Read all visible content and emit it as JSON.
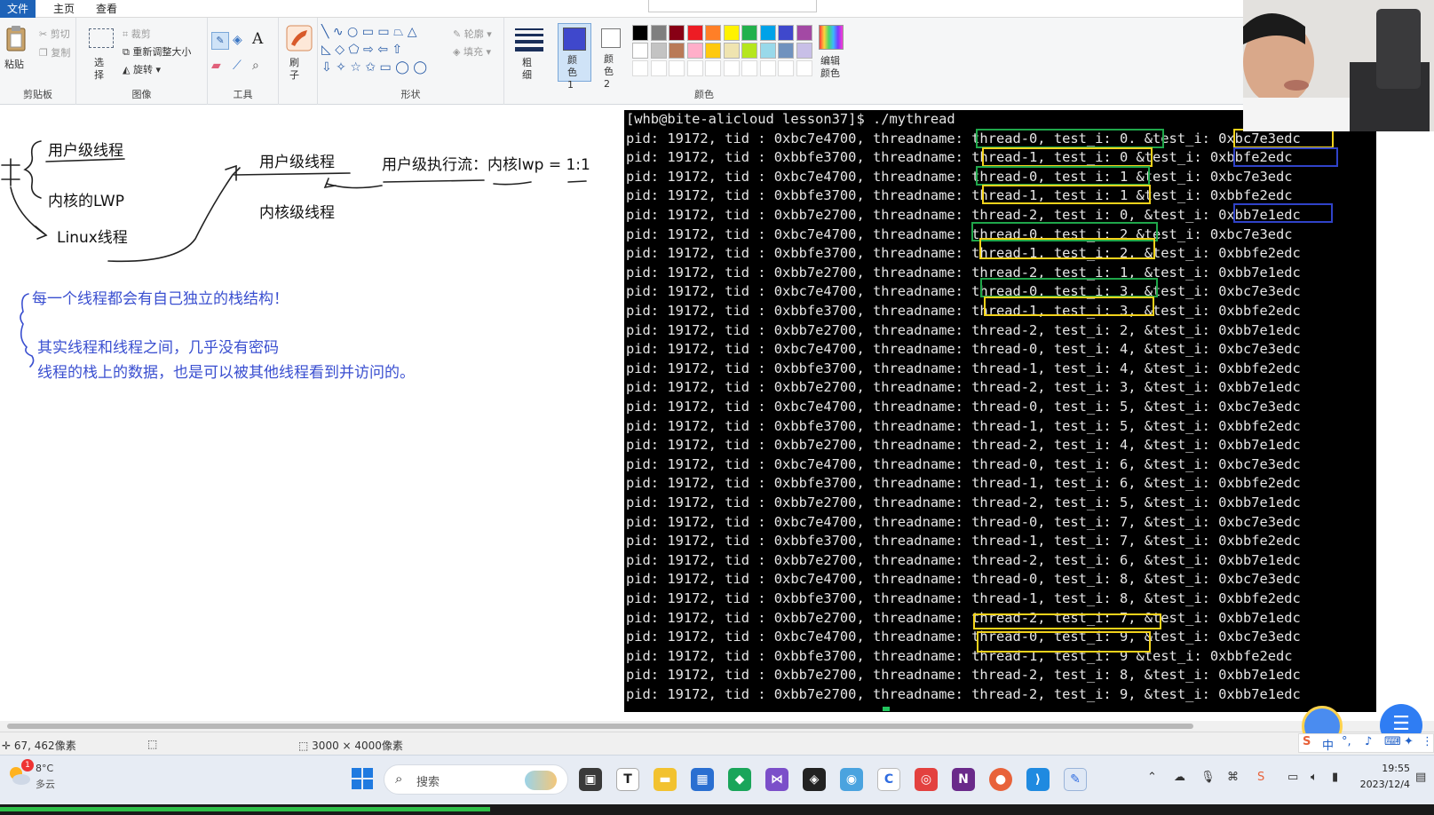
{
  "ribbon": {
    "tabs": [
      "文件",
      "主页",
      "查看"
    ],
    "clipboard": {
      "paste": "粘贴",
      "cut": "剪切",
      "copy": "复制",
      "label": "剪贴板"
    },
    "image": {
      "select": "选择",
      "crop": "裁剪",
      "resize": "重新调整大小",
      "rotate": "旋转",
      "label": "图像"
    },
    "tools": {
      "label": "工具"
    },
    "brushes": {
      "label": "刷子"
    },
    "shapes": {
      "outline": "轮廓",
      "fill": "填充",
      "label": "形状"
    },
    "size": {
      "label": "粗细"
    },
    "colors": {
      "color1": "颜色 1",
      "color2": "颜色 2",
      "edit": "编辑颜色",
      "label": "颜色",
      "active_color": "#3f48cc",
      "palette_row1": [
        "#000000",
        "#7f7f7f",
        "#880015",
        "#ed1c24",
        "#ff7f27",
        "#fff200",
        "#22b14c",
        "#00a2e8",
        "#3f48cc",
        "#a349a4"
      ],
      "palette_row2": [
        "#ffffff",
        "#c3c3c3",
        "#b97a57",
        "#ffaec9",
        "#ffc90e",
        "#efe4b0",
        "#b5e61d",
        "#99d9ea",
        "#7092be",
        "#c8bfe7"
      ]
    }
  },
  "canvas": {
    "notes_black": {
      "user_thread": "用户级线程",
      "kernel_lwp": "内核的LWP",
      "linux_thread": "Linux线程",
      "user_thread2": "用户级线程",
      "kernel_thread": "内核级线程",
      "mapping": "用户级执行流：内核lwp = 1:1"
    },
    "notes_blue": {
      "line1": "每一个线程都会有自己独立的栈结构！",
      "line2": "其实线程和线程之间，几乎没有密码",
      "line3": "线程的栈上的数据，也是可以被其他线程看到并访问的。"
    }
  },
  "terminal": {
    "prompt": "[whb@bite-alicloud lesson37]$ ./mythread",
    "lines": [
      {
        "pid": "19172",
        "tid": "0xbc7e4700",
        "name": "thread-0",
        "i": "0.",
        "addr": "0xbc7e3edc"
      },
      {
        "pid": "19172",
        "tid": "0xbbfe3700",
        "name": "thread-1",
        "i": "0",
        "addr": "0xbbfe2edc"
      },
      {
        "pid": "19172",
        "tid": "0xbc7e4700",
        "name": "thread-0",
        "i": "1",
        "addr": "0xbc7e3edc"
      },
      {
        "pid": "19172",
        "tid": "0xbbfe3700",
        "name": "thread-1",
        "i": "1",
        "addr": "0xbbfe2edc"
      },
      {
        "pid": "19172",
        "tid": "0xbb7e2700",
        "name": "thread-2",
        "i": "0,",
        "addr": "0xbb7e1edc"
      },
      {
        "pid": "19172",
        "tid": "0xbc7e4700",
        "name": "thread-0",
        "i": "2",
        "addr": "0xbc7e3edc"
      },
      {
        "pid": "19172",
        "tid": "0xbbfe3700",
        "name": "thread-1",
        "i": "2,",
        "addr": "0xbbfe2edc"
      },
      {
        "pid": "19172",
        "tid": "0xbb7e2700",
        "name": "thread-2",
        "i": "1,",
        "addr": "0xbb7e1edc"
      },
      {
        "pid": "19172",
        "tid": "0xbc7e4700",
        "name": "thread-0",
        "i": "3,",
        "addr": "0xbc7e3edc"
      },
      {
        "pid": "19172",
        "tid": "0xbbfe3700",
        "name": "thread-1",
        "i": "3,",
        "addr": "0xbbfe2edc"
      },
      {
        "pid": "19172",
        "tid": "0xbb7e2700",
        "name": "thread-2",
        "i": "2,",
        "addr": "0xbb7e1edc"
      },
      {
        "pid": "19172",
        "tid": "0xbc7e4700",
        "name": "thread-0",
        "i": "4,",
        "addr": "0xbc7e3edc"
      },
      {
        "pid": "19172",
        "tid": "0xbbfe3700",
        "name": "thread-1",
        "i": "4,",
        "addr": "0xbbfe2edc"
      },
      {
        "pid": "19172",
        "tid": "0xbb7e2700",
        "name": "thread-2",
        "i": "3,",
        "addr": "0xbb7e1edc"
      },
      {
        "pid": "19172",
        "tid": "0xbc7e4700",
        "name": "thread-0",
        "i": "5,",
        "addr": "0xbc7e3edc"
      },
      {
        "pid": "19172",
        "tid": "0xbbfe3700",
        "name": "thread-1",
        "i": "5,",
        "addr": "0xbbfe2edc"
      },
      {
        "pid": "19172",
        "tid": "0xbb7e2700",
        "name": "thread-2",
        "i": "4,",
        "addr": "0xbb7e1edc"
      },
      {
        "pid": "19172",
        "tid": "0xbc7e4700",
        "name": "thread-0",
        "i": "6,",
        "addr": "0xbc7e3edc"
      },
      {
        "pid": "19172",
        "tid": "0xbbfe3700",
        "name": "thread-1",
        "i": "6,",
        "addr": "0xbbfe2edc"
      },
      {
        "pid": "19172",
        "tid": "0xbb7e2700",
        "name": "thread-2",
        "i": "5,",
        "addr": "0xbb7e1edc"
      },
      {
        "pid": "19172",
        "tid": "0xbc7e4700",
        "name": "thread-0",
        "i": "7,",
        "addr": "0xbc7e3edc"
      },
      {
        "pid": "19172",
        "tid": "0xbbfe3700",
        "name": "thread-1",
        "i": "7,",
        "addr": "0xbbfe2edc"
      },
      {
        "pid": "19172",
        "tid": "0xbb7e2700",
        "name": "thread-2",
        "i": "6,",
        "addr": "0xbb7e1edc"
      },
      {
        "pid": "19172",
        "tid": "0xbc7e4700",
        "name": "thread-0",
        "i": "8,",
        "addr": "0xbc7e3edc"
      },
      {
        "pid": "19172",
        "tid": "0xbbfe3700",
        "name": "thread-1",
        "i": "8,",
        "addr": "0xbbfe2edc"
      },
      {
        "pid": "19172",
        "tid": "0xbb7e2700",
        "name": "thread-2",
        "i": "7,",
        "addr": "0xbb7e1edc"
      },
      {
        "pid": "19172",
        "tid": "0xbc7e4700",
        "name": "thread-0",
        "i": "9,",
        "addr": "0xbc7e3edc"
      },
      {
        "pid": "19172",
        "tid": "0xbbfe3700",
        "name": "thread-1",
        "i": "9",
        "addr": "0xbbfe2edc"
      },
      {
        "pid": "19172",
        "tid": "0xbb7e2700",
        "name": "thread-2",
        "i": "8,",
        "addr": "0xbb7e1edc"
      },
      {
        "pid": "19172",
        "tid": "0xbb7e2700",
        "name": "thread-2",
        "i": "9,",
        "addr": "0xbb7e1edc"
      }
    ],
    "highlight_colors": {
      "green": "#1fa64a",
      "yellow": "#f2d21b",
      "blue": "#3043c9"
    }
  },
  "status": {
    "cursor": "67, 462像素",
    "size": "3000 × 4000像素"
  },
  "taskbar": {
    "weather_temp": "8°C",
    "weather_desc": "多云",
    "weather_badge": "1",
    "search_placeholder": "搜索",
    "time": "19:55",
    "date": "2023/12/4",
    "ime": "中",
    "recording_progress": 0.342
  }
}
